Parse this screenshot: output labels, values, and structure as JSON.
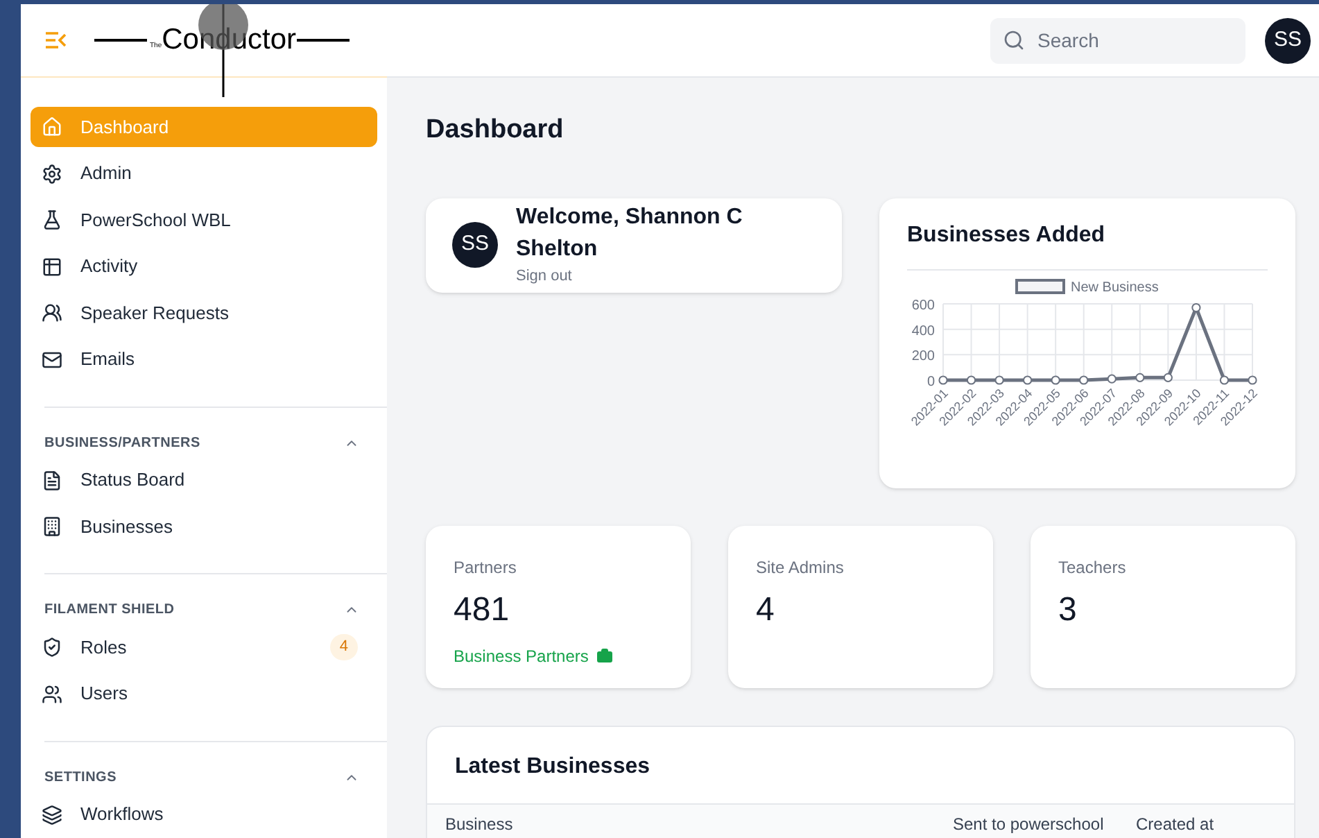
{
  "header": {
    "logo": {
      "prefix": "The",
      "name": "Conductor"
    },
    "search": {
      "placeholder": "Search"
    },
    "avatar": "SS"
  },
  "sidebar": {
    "items": [
      {
        "label": "Dashboard",
        "selected": true
      },
      {
        "label": "Admin",
        "selected": false
      },
      {
        "label": "PowerSchool WBL",
        "selected": false
      },
      {
        "label": "Activity",
        "selected": false
      },
      {
        "label": "Speaker Requests",
        "selected": false
      },
      {
        "label": "Emails",
        "selected": false
      }
    ],
    "groups": [
      {
        "title": "BUSINESS/PARTNERS",
        "expanded": true,
        "items": [
          {
            "label": "Status Board",
            "selected": false
          },
          {
            "label": "Businesses",
            "selected": false
          }
        ]
      },
      {
        "title": "FILAMENT SHIELD",
        "expanded": true,
        "items": [
          {
            "label": "Roles",
            "selected": false,
            "badge": "4"
          },
          {
            "label": "Users",
            "selected": false
          }
        ]
      },
      {
        "title": "SETTINGS",
        "expanded": true,
        "items": [
          {
            "label": "Workflows",
            "selected": false
          }
        ]
      }
    ]
  },
  "page_title": "Dashboard",
  "welcome": {
    "avatar": "SS",
    "greeting": "Welcome, Shannon C Shelton",
    "sign_out": "Sign out"
  },
  "businesses_added": {
    "title": "Businesses Added",
    "chart_data": {
      "type": "line",
      "categories": [
        "2022-01",
        "2022-02",
        "2022-03",
        "2022-04",
        "2022-05",
        "2022-06",
        "2022-07",
        "2022-08",
        "2022-09",
        "2022-10",
        "2022-11",
        "2022-12"
      ],
      "series": [
        {
          "name": "New Business",
          "color": "#6b7280",
          "values": [
            0,
            0,
            0,
            0,
            0,
            0,
            10,
            20,
            20,
            570,
            0,
            0
          ],
          "marker": true
        }
      ],
      "ylim": [
        0,
        600
      ],
      "yticks": [
        0,
        200,
        400,
        600
      ],
      "grid": true
    }
  },
  "stats": [
    {
      "label": "Partners",
      "value": "481",
      "link": "Business Partners"
    },
    {
      "label": "Site Admins",
      "value": "4"
    },
    {
      "label": "Teachers",
      "value": "3"
    }
  ],
  "latest": {
    "title": "Latest Businesses",
    "columns": [
      "Business",
      "Sent to powerschool",
      "Created at"
    ]
  }
}
